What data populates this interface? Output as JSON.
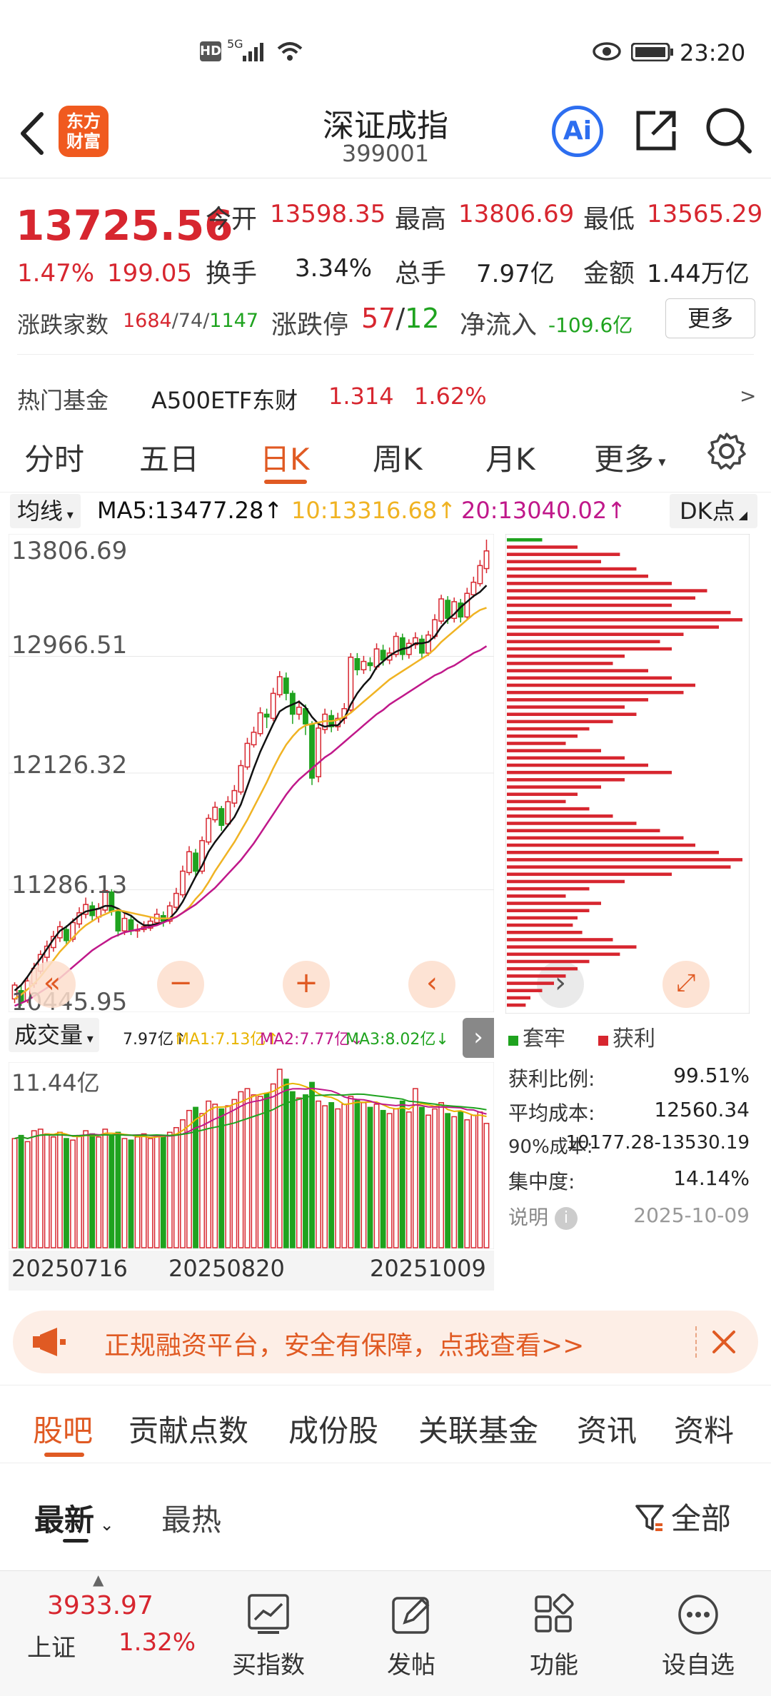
{
  "status": {
    "time": "23:20",
    "net": "5G"
  },
  "header": {
    "title": "深证成指",
    "code": "399001",
    "logo": "东方\n财富",
    "logo_line1": "东方",
    "logo_line2": "财富",
    "ai_label": "Ai"
  },
  "quote": {
    "price": "13725.56",
    "change_pct": "1.47%",
    "change": "199.05",
    "open_label": "今开",
    "open": "13598.35",
    "high_label": "最高",
    "high": "13806.69",
    "low_label": "最低",
    "low": "13565.29",
    "turnover_label": "换手",
    "turnover": "3.34%",
    "volume_label": "总手",
    "volume": "7.97亿",
    "amount_label": "金额",
    "amount": "1.44万亿",
    "breadth_label": "涨跌家数",
    "breadth_up": "1684",
    "breadth_flat": "74",
    "breadth_down": "1147",
    "limit_label": "涨跌停",
    "limit_up": "57",
    "limit_down": "12",
    "netflow_label": "净流入",
    "netflow": "-109.6亿",
    "more_button": "更多",
    "fund_label": "热门基金",
    "fund_name": "A500ETF东财",
    "fund_price": "1.314",
    "fund_pct": "1.62%",
    "fund_arrow": ">"
  },
  "tabs": [
    "分时",
    "五日",
    "日K",
    "周K",
    "月K",
    "更多"
  ],
  "active_tab": "日K",
  "ma_bar": {
    "selector": "均线",
    "ma5": "MA5:13477.28",
    "ma10": "10:13316.68",
    "ma20": "20:13040.02",
    "dk": "DK点"
  },
  "price_axis": [
    "13806.69",
    "12966.51",
    "12126.32",
    "11286.13",
    "10445.95"
  ],
  "volume_bar": {
    "selector": "成交量",
    "v": "7.97亿",
    "ma1": "MA1:7.13亿",
    "ma2": "MA2:7.77亿",
    "ma3": "MA3:8.02亿",
    "max": "11.44亿"
  },
  "dates": [
    "20250716",
    "20250820",
    "20251009"
  ],
  "chips": {
    "legend_trapped": "套牢",
    "legend_profit": "获利",
    "profit_ratio_label": "获利比例:",
    "profit_ratio": "99.51%",
    "avg_cost_label": "平均成本:",
    "avg_cost": "12560.34",
    "cost90_label": "90%成本:",
    "cost90": "10177.28-13530.19",
    "concentration_label": "集中度:",
    "concentration": "14.14%",
    "note_label": "说明",
    "date": "2025-10-09"
  },
  "banner": {
    "text": "正规融资平台，安全有保障，点我查看>>"
  },
  "subtabs": [
    "股吧",
    "贡献点数",
    "成份股",
    "关联基金",
    "资讯",
    "资料"
  ],
  "filter": {
    "latest": "最新",
    "hot": "最热",
    "all": "全部"
  },
  "bottom": {
    "index_value": "3933.97",
    "index_name": "上证",
    "index_pct": "1.32%",
    "items": [
      "买指数",
      "发帖",
      "功能",
      "设自选"
    ]
  },
  "colors": {
    "up": "#d7262f",
    "down": "#1fa31f",
    "accent": "#e05a23",
    "ma5": "#111111",
    "ma10": "#f0b323",
    "ma20": "#c0188a"
  },
  "chart_data": {
    "type": "candlestick",
    "ylim": [
      10445.95,
      13806.69
    ],
    "candles": [
      [
        10500,
        10600,
        10470,
        10620
      ],
      [
        10560,
        10480,
        10450,
        10600
      ],
      [
        10490,
        10630,
        10470,
        10660
      ],
      [
        10610,
        10720,
        10580,
        10760
      ],
      [
        10700,
        10820,
        10680,
        10850
      ],
      [
        10800,
        10880,
        10760,
        10920
      ],
      [
        10870,
        10950,
        10840,
        10990
      ],
      [
        10940,
        11020,
        10910,
        11060
      ],
      [
        11000,
        10920,
        10890,
        11030
      ],
      [
        10930,
        11050,
        10910,
        11080
      ],
      [
        11040,
        11120,
        11010,
        11160
      ],
      [
        11110,
        11180,
        11080,
        11230
      ],
      [
        11170,
        11100,
        11060,
        11200
      ],
      [
        11090,
        11150,
        11050,
        11190
      ],
      [
        11140,
        11280,
        11120,
        11300
      ],
      [
        11270,
        11130,
        11100,
        11290
      ],
      [
        11130,
        10990,
        10950,
        11150
      ],
      [
        10990,
        11080,
        10960,
        11120
      ],
      [
        11070,
        10990,
        10960,
        11100
      ],
      [
        10990,
        11000,
        10940,
        11040
      ],
      [
        11000,
        11020,
        10980,
        11060
      ],
      [
        11010,
        11060,
        10990,
        11090
      ],
      [
        11050,
        11110,
        11030,
        11150
      ],
      [
        11100,
        11060,
        11020,
        11130
      ],
      [
        11060,
        11170,
        11040,
        11200
      ],
      [
        11160,
        11260,
        11140,
        11300
      ],
      [
        11250,
        11420,
        11230,
        11460
      ],
      [
        11410,
        11560,
        11390,
        11600
      ],
      [
        11550,
        11420,
        11380,
        11580
      ],
      [
        11420,
        11640,
        11400,
        11670
      ],
      [
        11630,
        11800,
        11610,
        11830
      ],
      [
        11790,
        11880,
        11770,
        11920
      ],
      [
        11870,
        11750,
        11710,
        11890
      ],
      [
        11760,
        11920,
        11740,
        11960
      ],
      [
        11910,
        12000,
        11880,
        12040
      ],
      [
        11990,
        12180,
        11970,
        12220
      ],
      [
        12170,
        12340,
        12150,
        12380
      ],
      [
        12330,
        12420,
        12310,
        12460
      ],
      [
        12410,
        12560,
        12390,
        12600
      ],
      [
        12550,
        12530,
        12450,
        12590
      ],
      [
        12520,
        12700,
        12500,
        12740
      ],
      [
        12690,
        12820,
        12670,
        12860
      ],
      [
        12810,
        12700,
        12650,
        12850
      ],
      [
        12700,
        12550,
        12480,
        12720
      ],
      [
        12550,
        12600,
        12510,
        12650
      ],
      [
        12590,
        12480,
        12400,
        12620
      ],
      [
        12480,
        12090,
        12040,
        12500
      ],
      [
        12100,
        12450,
        12060,
        12480
      ],
      [
        12440,
        12550,
        12410,
        12590
      ],
      [
        12540,
        12460,
        12420,
        12580
      ],
      [
        12460,
        12520,
        12430,
        12560
      ],
      [
        12520,
        12590,
        12480,
        12630
      ],
      [
        12580,
        12960,
        12560,
        12990
      ],
      [
        12950,
        12870,
        12830,
        12990
      ],
      [
        12870,
        12930,
        12840,
        12970
      ],
      [
        12920,
        12900,
        12860,
        12960
      ],
      [
        12890,
        13020,
        12870,
        13060
      ],
      [
        13010,
        12940,
        12900,
        13050
      ],
      [
        12940,
        12990,
        12910,
        13030
      ],
      [
        12980,
        13110,
        12960,
        13140
      ],
      [
        13100,
        12980,
        12940,
        13130
      ],
      [
        12980,
        13060,
        12950,
        13090
      ],
      [
        13050,
        13100,
        13020,
        13140
      ],
      [
        13090,
        12990,
        12950,
        13120
      ],
      [
        12990,
        13120,
        12970,
        13150
      ],
      [
        13110,
        13230,
        13090,
        13270
      ],
      [
        13220,
        13380,
        13200,
        13410
      ],
      [
        13370,
        13240,
        13200,
        13400
      ],
      [
        13240,
        13360,
        13210,
        13390
      ],
      [
        13350,
        13250,
        13210,
        13380
      ],
      [
        13250,
        13420,
        13230,
        13460
      ],
      [
        13410,
        13500,
        13390,
        13540
      ],
      [
        13490,
        13620,
        13470,
        13660
      ],
      [
        13598.35,
        13725.56,
        13565.29,
        13806.69
      ]
    ],
    "volume": [
      7.0,
      7.2,
      6.8,
      7.5,
      7.6,
      7.3,
      7.1,
      7.4,
      7.0,
      6.9,
      7.2,
      7.5,
      7.3,
      7.1,
      7.6,
      7.2,
      7.4,
      7.0,
      6.9,
      7.1,
      7.3,
      7.0,
      7.2,
      7.1,
      7.4,
      7.7,
      8.2,
      8.8,
      9.0,
      8.6,
      9.4,
      9.2,
      8.9,
      9.1,
      9.5,
      10.0,
      10.2,
      9.8,
      9.7,
      9.9,
      10.5,
      11.44,
      10.8,
      10.0,
      9.6,
      9.8,
      10.6,
      9.4,
      9.1,
      9.3,
      8.9,
      9.2,
      9.7,
      9.5,
      9.3,
      9.0,
      9.2,
      8.8,
      8.6,
      8.9,
      9.4,
      8.7,
      10.2,
      9.0,
      8.5,
      8.9,
      9.3,
      8.6,
      8.4,
      8.7,
      8.2,
      8.5,
      8.7,
      7.97
    ],
    "ma5": [
      10560,
      10600,
      10660,
      10730,
      10790,
      10860,
      10930,
      10990,
      11020,
      11060,
      11100,
      11130,
      11140,
      11150,
      11170,
      11170,
      11150,
      11120,
      11100,
      11060,
      11030,
      11030,
      11040,
      11050,
      11080,
      11130,
      11200,
      11290,
      11380,
      11460,
      11560,
      11630,
      11690,
      11750,
      11810,
      11900,
      12030,
      12160,
      12280,
      12380,
      12480,
      12570,
      12600,
      12620,
      12640,
      12600,
      12530,
      12480,
      12460,
      12470,
      12470,
      12520,
      12620,
      12700,
      12760,
      12810,
      12890,
      12930,
      12970,
      13000,
      13020,
      13030,
      13060,
      13060,
      13070,
      13110,
      13180,
      13230,
      13270,
      13320,
      13360,
      13400,
      13430,
      13477.28
    ],
    "ma10": [
      10500,
      10530,
      10570,
      10610,
      10660,
      10720,
      10780,
      10840,
      10890,
      10940,
      10990,
      11030,
      11060,
      11090,
      11110,
      11130,
      11140,
      11130,
      11120,
      11110,
      11100,
      11090,
      11080,
      11080,
      11080,
      11090,
      11120,
      11160,
      11220,
      11270,
      11340,
      11420,
      11490,
      11560,
      11630,
      11710,
      11790,
      11880,
      11970,
      12060,
      12160,
      12250,
      12330,
      12390,
      12440,
      12470,
      12480,
      12490,
      12500,
      12500,
      12510,
      12530,
      12560,
      12600,
      12640,
      12680,
      12720,
      12760,
      12800,
      12830,
      12860,
      12890,
      12920,
      12950,
      12980,
      13020,
      13070,
      13110,
      13150,
      13190,
      13230,
      13270,
      13300,
      13316.68
    ],
    "ma20": [
      10450,
      10470,
      10490,
      10520,
      10550,
      10580,
      10610,
      10650,
      10690,
      10730,
      10770,
      10810,
      10850,
      10880,
      10910,
      10940,
      10960,
      10980,
      10990,
      11000,
      11010,
      11020,
      11030,
      11050,
      11070,
      11090,
      11120,
      11150,
      11180,
      11220,
      11260,
      11300,
      11350,
      11400,
      11450,
      11500,
      11560,
      11620,
      11690,
      11760,
      11830,
      11900,
      11970,
      12030,
      12080,
      12120,
      12160,
      12200,
      12240,
      12270,
      12310,
      12350,
      12390,
      12430,
      12470,
      12510,
      12550,
      12580,
      12620,
      12650,
      12680,
      12710,
      12740,
      12770,
      12800,
      12830,
      12850,
      12880,
      12900,
      12930,
      12960,
      12990,
      13010,
      13040.02
    ],
    "chip_profile": [
      0.15,
      0.3,
      0.48,
      0.4,
      0.55,
      0.6,
      0.7,
      0.85,
      0.8,
      0.7,
      0.95,
      1.0,
      0.9,
      0.75,
      0.65,
      0.7,
      0.5,
      0.45,
      0.6,
      0.7,
      0.8,
      0.75,
      0.6,
      0.5,
      0.55,
      0.45,
      0.35,
      0.3,
      0.25,
      0.4,
      0.5,
      0.6,
      0.7,
      0.5,
      0.4,
      0.3,
      0.25,
      0.35,
      0.45,
      0.55,
      0.65,
      0.75,
      0.8,
      0.9,
      1.0,
      0.95,
      0.7,
      0.5,
      0.35,
      0.25,
      0.4,
      0.35,
      0.3,
      0.28,
      0.32,
      0.45,
      0.55,
      0.48,
      0.35,
      0.3,
      0.25,
      0.2,
      0.15,
      0.1,
      0.08
    ]
  }
}
